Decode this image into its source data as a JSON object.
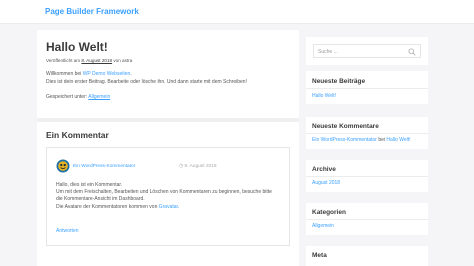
{
  "header": {
    "site_title": "Page Builder Framework"
  },
  "post": {
    "title": "Hallo Welt!",
    "meta_prefix": "Veröffentlicht am",
    "meta_date": "8. August 2018",
    "meta_by": "von astra",
    "line1_prefix": "Willkommen bei",
    "line1_link": "WP Demo Webseiten",
    "line1_suffix": ".",
    "line2": "Dies ist dein erster Beitrag. Bearbeite oder lösche ihn. Und dann starte mit dem Schreiben!",
    "category_prefix": "Gespeichert unter:",
    "category_link": "Allgemein"
  },
  "comments": {
    "title": "Ein Kommentar",
    "author": "Ein WordPress-Kommentator",
    "date": "8. August 2018",
    "body_line1": "Hallo, dies ist ein Kommentar.",
    "body_line2": "Um mit dem Freischalten, Bearbeiten und Löschen von Kommentaren zu beginnen, besuche bitte",
    "body_line3": "die Kommentare-Ansicht im Dashboard.",
    "body_line4_prefix": "Die Avatare der Kommentatoren kommen von",
    "body_line4_link": "Gravatar",
    "body_line4_suffix": ".",
    "reply": "Antworten"
  },
  "sidebar": {
    "search_placeholder": "Suche ...",
    "recent_posts_title": "Neueste Beiträge",
    "recent_post": "Hallo Welt!",
    "recent_comments_title": "Neueste Kommentare",
    "recent_comment_author": "Ein WordPress-Kommentator",
    "recent_comment_mid": "bei",
    "recent_comment_post": "Hallo Welt!",
    "archive_title": "Archive",
    "archive_item": "August 2018",
    "categories_title": "Kategorien",
    "category_item": "Allgemein",
    "meta_title": "Meta"
  },
  "colors": {
    "accent": "#3ba0ff",
    "background": "#f5f5f7"
  }
}
